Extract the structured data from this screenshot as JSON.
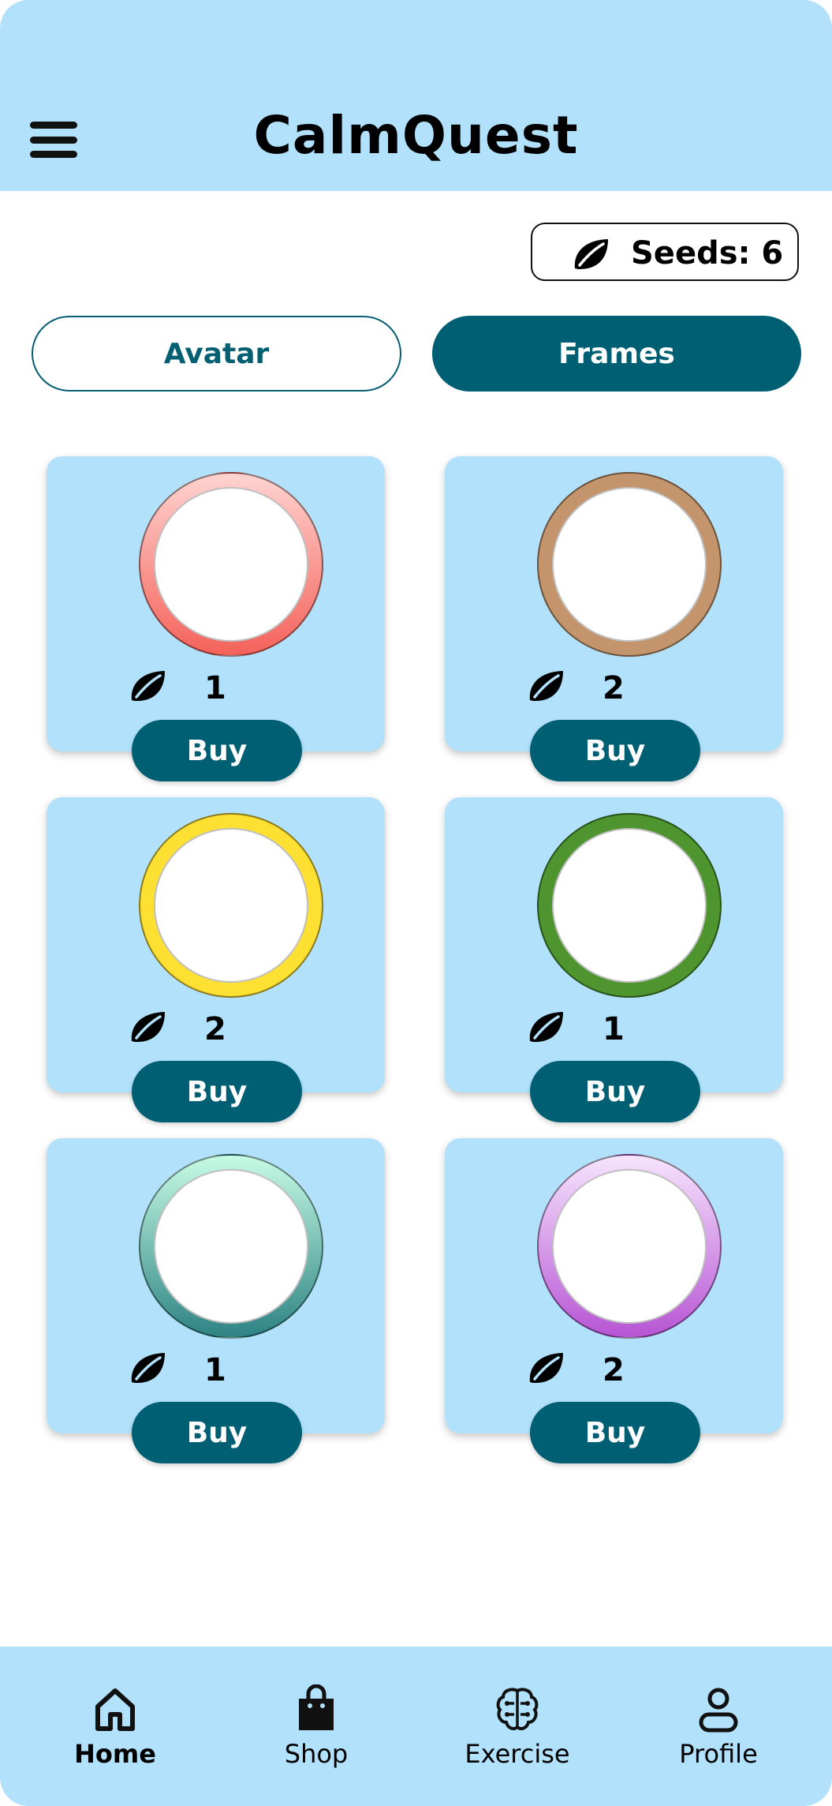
{
  "app": {
    "title": "CalmQuest"
  },
  "header": {
    "menu_icon": "hamburger-menu-icon"
  },
  "seeds": {
    "icon": "leaf-icon",
    "label": "Seeds: 6"
  },
  "tabs": [
    {
      "label": "Avatar",
      "active": false
    },
    {
      "label": "Frames",
      "active": true
    }
  ],
  "frames": [
    {
      "price": "1",
      "buy_label": "Buy",
      "ring": "gradient-red",
      "colors": [
        "#ffd3d0",
        "#f4625a"
      ]
    },
    {
      "price": "2",
      "buy_label": "Buy",
      "ring": "tan",
      "colors": [
        "#c4956c",
        "#c4956c"
      ]
    },
    {
      "price": "2",
      "buy_label": "Buy",
      "ring": "yellow",
      "colors": [
        "#fde032",
        "#fde032"
      ]
    },
    {
      "price": "1",
      "buy_label": "Buy",
      "ring": "green",
      "colors": [
        "#4e952f",
        "#4e952f"
      ]
    },
    {
      "price": "1",
      "buy_label": "Buy",
      "ring": "gradient-teal",
      "colors": [
        "#c6fbe4",
        "#2e8384"
      ]
    },
    {
      "price": "2",
      "buy_label": "Buy",
      "ring": "gradient-purple",
      "colors": [
        "#f6e4fd",
        "#b755d4"
      ]
    }
  ],
  "nav": [
    {
      "label": "Home",
      "icon": "home-icon",
      "active": true
    },
    {
      "label": "Shop",
      "icon": "shopping-bag-icon",
      "active": false
    },
    {
      "label": "Exercise",
      "icon": "brain-icon",
      "active": false
    },
    {
      "label": "Profile",
      "icon": "person-icon",
      "active": false
    }
  ],
  "colors": {
    "header_bg": "#b1e1fb",
    "accent": "#005f73",
    "card_bg": "#b1e1fb"
  }
}
